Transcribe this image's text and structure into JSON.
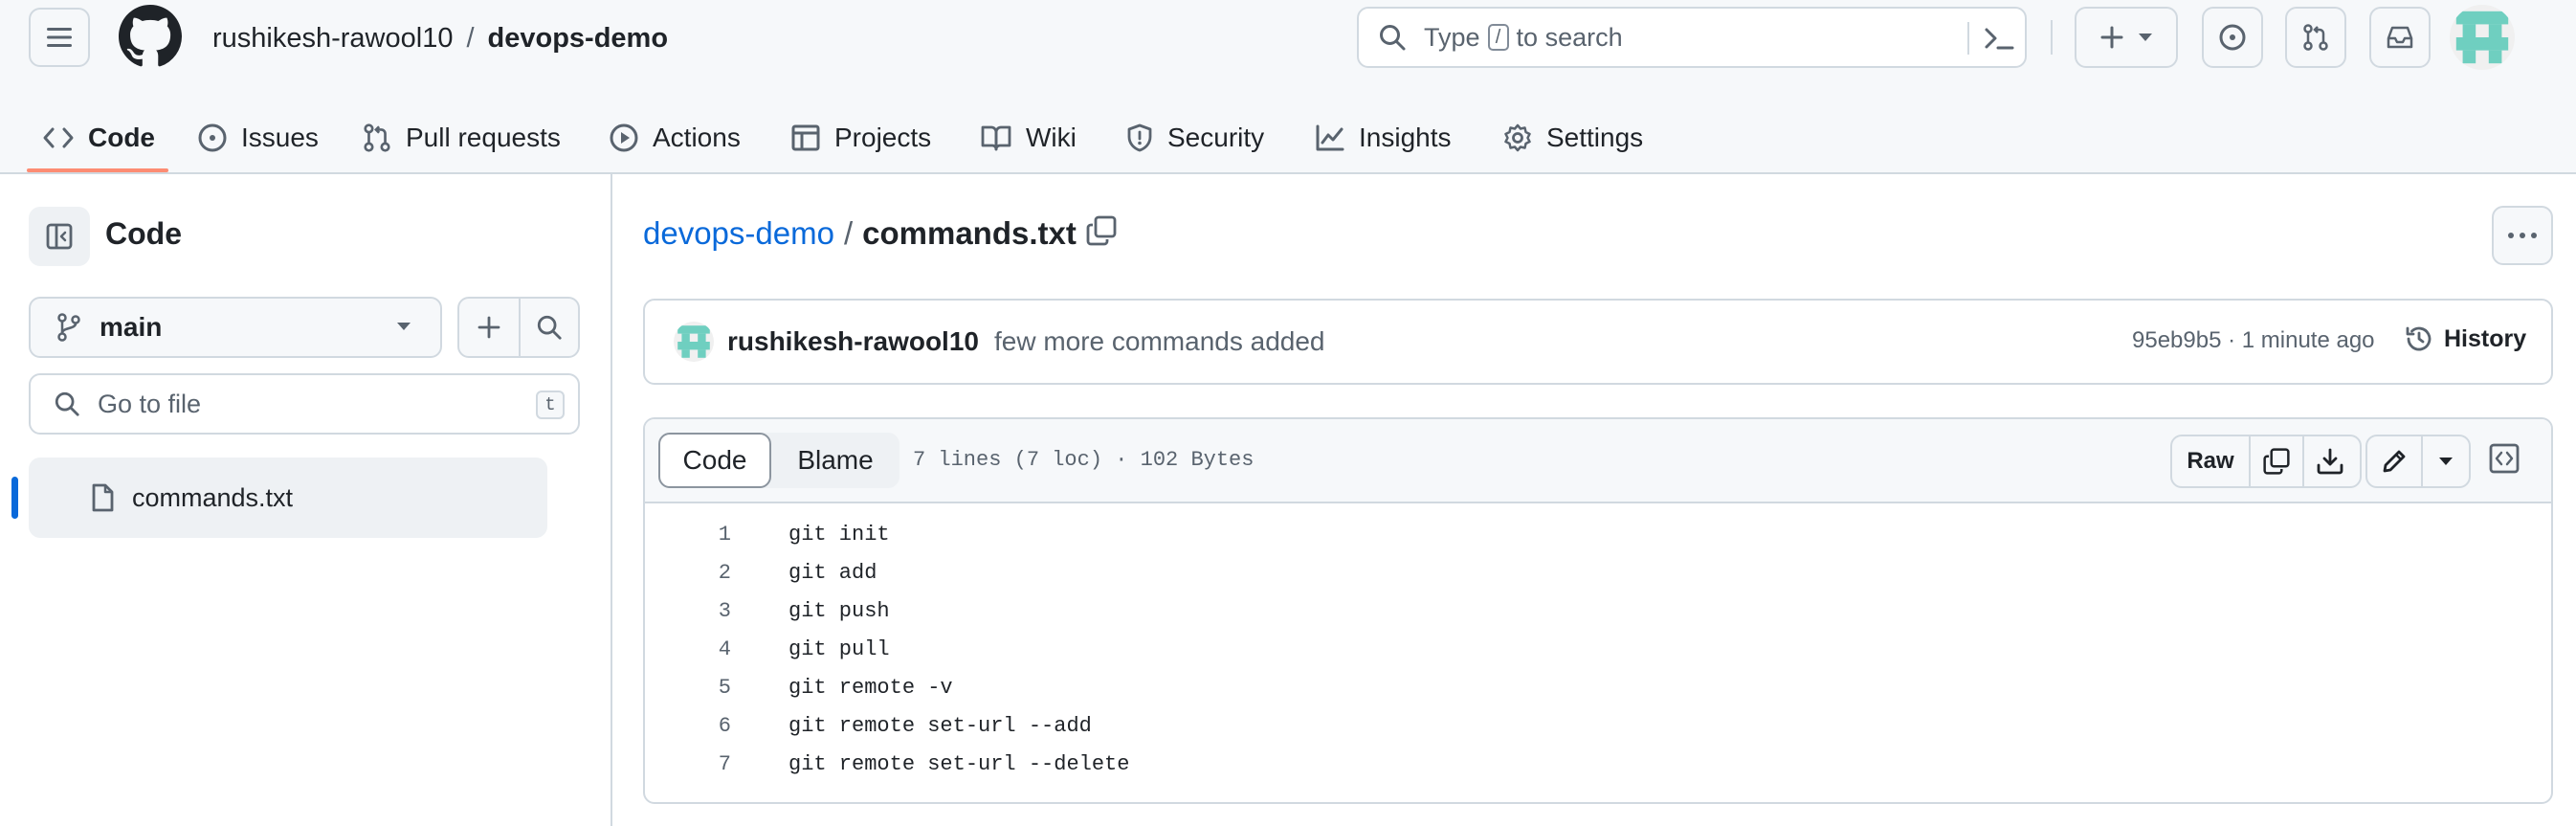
{
  "header": {
    "owner": "rushikesh-rawool10",
    "separator": "/",
    "repo": "devops-demo",
    "search": {
      "prefix": "Type",
      "key": "/",
      "suffix": "to search"
    },
    "create_label": "+",
    "icons": {
      "menu": "hamburger-menu-icon",
      "logo": "github-logo-icon",
      "command": "command-palette-icon",
      "issues": "issues-icon",
      "pulls": "pull-requests-icon",
      "inbox": "inbox-icon"
    }
  },
  "tabs": [
    {
      "label": "Code",
      "icon": "code-icon",
      "active": true
    },
    {
      "label": "Issues",
      "icon": "issue-opened-icon"
    },
    {
      "label": "Pull requests",
      "icon": "git-pull-request-icon"
    },
    {
      "label": "Actions",
      "icon": "play-icon"
    },
    {
      "label": "Projects",
      "icon": "table-icon"
    },
    {
      "label": "Wiki",
      "icon": "book-icon"
    },
    {
      "label": "Security",
      "icon": "shield-icon"
    },
    {
      "label": "Insights",
      "icon": "graph-icon"
    },
    {
      "label": "Settings",
      "icon": "gear-icon"
    }
  ],
  "sidebar": {
    "title": "Code",
    "branch": "main",
    "goto_placeholder": "Go to file",
    "goto_key": "t",
    "files": [
      {
        "name": "commands.txt",
        "selected": true
      }
    ]
  },
  "main": {
    "breadcrumb": {
      "repo": "devops-demo",
      "separator": "/",
      "file": "commands.txt"
    },
    "commit": {
      "author": "rushikesh-rawool10",
      "message": "few more commands added",
      "meta": "95eb9b5 · 1 minute ago",
      "history_label": "History"
    },
    "file": {
      "tab_code": "Code",
      "tab_blame": "Blame",
      "info": "7 lines (7 loc) · 102 Bytes",
      "raw_label": "Raw",
      "lines": [
        {
          "n": "1",
          "text": "git init"
        },
        {
          "n": "2",
          "text": "git add"
        },
        {
          "n": "3",
          "text": "git push"
        },
        {
          "n": "4",
          "text": "git pull"
        },
        {
          "n": "5",
          "text": "git remote -v"
        },
        {
          "n": "6",
          "text": "git remote set-url --add"
        },
        {
          "n": "7",
          "text": "git remote set-url --delete"
        }
      ]
    }
  },
  "colors": {
    "accent_link": "#0969da",
    "tab_underline": "#fd8c73",
    "header_bg": "#f6f8fa",
    "avatar_teal": "#6fcfc0"
  }
}
